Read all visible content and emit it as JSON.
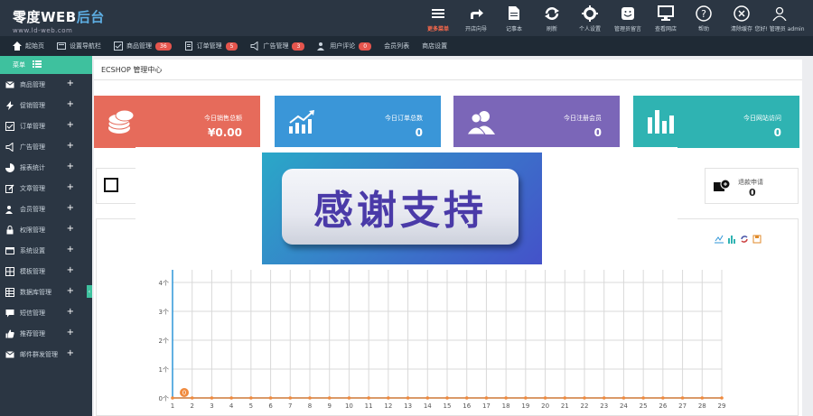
{
  "app": {
    "logo_main": "零度WEB",
    "logo_accent": "后台",
    "logo_sub": "www.ld-web.com"
  },
  "topnav": [
    {
      "label": "更多菜单",
      "icon": "menu-icon",
      "active": true
    },
    {
      "label": "开店向导",
      "icon": "share-icon",
      "active": false
    },
    {
      "label": "记事本",
      "icon": "notepad-icon",
      "active": false
    },
    {
      "label": "刷新",
      "icon": "refresh-icon",
      "active": false
    },
    {
      "label": "个人设置",
      "icon": "gear-icon",
      "active": false
    },
    {
      "label": "管理员留言",
      "icon": "chat-icon",
      "active": false
    },
    {
      "label": "查看网店",
      "icon": "monitor-icon",
      "active": false
    },
    {
      "label": "帮助",
      "icon": "help-icon",
      "active": false
    },
    {
      "label": "清除缓存",
      "icon": "clear-icon",
      "active": false
    },
    {
      "label": "您好! 管理员 admin",
      "icon": "user-icon",
      "active": false
    }
  ],
  "subbar": [
    {
      "label": "起始页",
      "icon": "home-icon",
      "badge": ""
    },
    {
      "label": "设置导航栏",
      "icon": "settings-icon",
      "badge": ""
    },
    {
      "label": "商品管理",
      "icon": "check-icon",
      "badge": "36"
    },
    {
      "label": "订单管理",
      "icon": "order-icon",
      "badge": "5"
    },
    {
      "label": "广告管理",
      "icon": "speaker-icon",
      "badge": "3"
    },
    {
      "label": "用户评论",
      "icon": "users-icon",
      "badge": "0"
    },
    {
      "label": "会员列表",
      "icon": "",
      "badge": ""
    },
    {
      "label": "商店设置",
      "icon": "",
      "badge": ""
    }
  ],
  "sidebar": {
    "header": "菜单",
    "items": [
      {
        "label": "商品管理",
        "icon": "mail-icon"
      },
      {
        "label": "促销管理",
        "icon": "bolt-icon"
      },
      {
        "label": "订单管理",
        "icon": "check-icon"
      },
      {
        "label": "广告管理",
        "icon": "speaker-icon"
      },
      {
        "label": "报表统计",
        "icon": "pie-icon"
      },
      {
        "label": "文章管理",
        "icon": "edit-icon"
      },
      {
        "label": "会员管理",
        "icon": "users-icon"
      },
      {
        "label": "权限管理",
        "icon": "lock-icon"
      },
      {
        "label": "系统设置",
        "icon": "window-icon"
      },
      {
        "label": "模板管理",
        "icon": "grid-icon"
      },
      {
        "label": "数据库管理",
        "icon": "table-icon"
      },
      {
        "label": "短信管理",
        "icon": "comment-icon"
      },
      {
        "label": "推荐管理",
        "icon": "thumb-icon"
      },
      {
        "label": "邮件群发管理",
        "icon": "mail-icon"
      }
    ]
  },
  "main": {
    "title": "ECSHOP 管理中心",
    "cards": [
      {
        "label": "今日销售总额",
        "value": "¥0.00",
        "color": "#e66b5b",
        "icon": "coins-icon"
      },
      {
        "label": "今日订单总数",
        "value": "0",
        "color": "#3a96d8",
        "icon": "chart-up-icon"
      },
      {
        "label": "今日注册会员",
        "value": "0",
        "color": "#7b66b8",
        "icon": "users-icon"
      },
      {
        "label": "今日网站访问",
        "value": "0",
        "color": "#2fb3b2",
        "icon": "bars-icon"
      }
    ],
    "info_boxes": [
      {
        "label": "",
        "value": "",
        "icon": "square-icon"
      },
      {
        "label": "退款申请",
        "value": "0",
        "icon": "refund-icon"
      }
    ],
    "chart_tools": [
      "line-chart-icon",
      "bar-chart-icon",
      "refresh-icon",
      "save-icon"
    ]
  },
  "overlay": {
    "banner_text": "感谢支持"
  },
  "chart_data": {
    "type": "line",
    "x": [
      1,
      2,
      3,
      4,
      5,
      6,
      7,
      8,
      9,
      10,
      11,
      12,
      13,
      14,
      15,
      16,
      17,
      18,
      19,
      20,
      21,
      22,
      23,
      24,
      25,
      26,
      27,
      28,
      29
    ],
    "series": [
      {
        "values": [
          0,
          0,
          0,
          0,
          0,
          0,
          0,
          0,
          0,
          0,
          0,
          0,
          0,
          0,
          0,
          0,
          0,
          0,
          0,
          0,
          0,
          0,
          0,
          0,
          0,
          0,
          0,
          0,
          0
        ]
      }
    ],
    "ylim": [
      0,
      4
    ],
    "y_ticks": [
      "0个",
      "1个",
      "2个",
      "3个",
      "4个"
    ],
    "grid": true,
    "highlight_label": "0",
    "colors": {
      "line": "#f08a3e",
      "axis": "#2f95d8",
      "grid": "#d9d9d9"
    }
  }
}
